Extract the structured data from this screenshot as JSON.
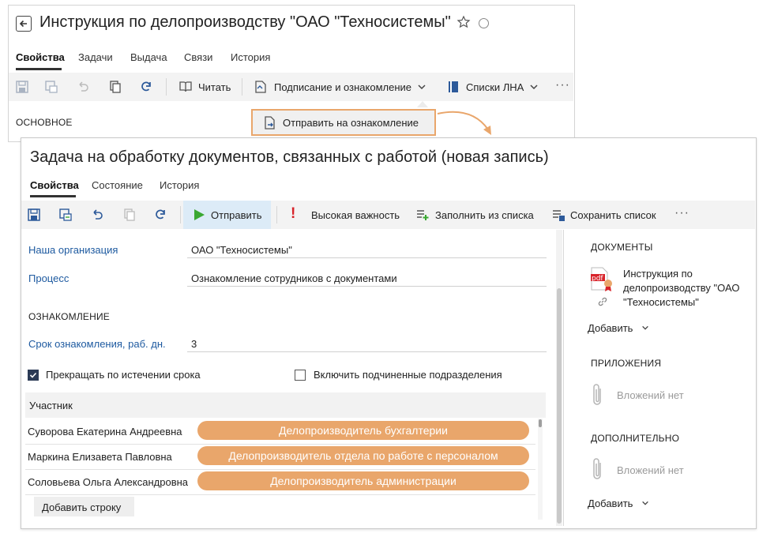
{
  "back_window": {
    "title": "Инструкция по делопроизводству \"ОАО \"Техносистемы\"",
    "tabs": [
      "Свойства",
      "Задачи",
      "Выдача",
      "Связи",
      "История"
    ],
    "toolbar": {
      "read_label": "Читать",
      "sign_label": "Подписание и ознакомление",
      "lna_label": "Списки ЛНА"
    },
    "section_label": "ОСНОВНОЕ",
    "dropdown_item": "Отправить на ознакомление"
  },
  "front_window": {
    "title": "Задача на обработку документов, связанных с работой (новая запись)",
    "tabs": [
      "Свойства",
      "Состояние",
      "История"
    ],
    "toolbar": {
      "send_label": "Отправить",
      "importance_label": "Высокая важность",
      "fill_label": "Заполнить из списка",
      "save_list_label": "Сохранить список"
    },
    "fields": {
      "org_label": "Наша организация",
      "org_value": "ОАО \"Техносистемы\"",
      "process_label": "Процесс",
      "process_value": "Ознакомление сотрудников с документами",
      "familiarization_header": "ОЗНАКОМЛЕНИЕ",
      "term_label": "Срок ознакомления, раб. дн.",
      "term_value": "3"
    },
    "checkboxes": {
      "stop_on_expiry": {
        "label": "Прекращать по истечении срока",
        "checked": true
      },
      "include_subdivisions": {
        "label": "Включить подчиненные подразделения",
        "checked": false
      }
    },
    "table": {
      "header": "Участник",
      "rows": [
        {
          "name": "Суворова Екатерина Андреевна",
          "role": "Делопроизводитель бухгалтерии"
        },
        {
          "name": "Маркина Елизавета Павловна",
          "role": "Делопроизводитель отдела по работе с персоналом"
        },
        {
          "name": "Соловьева Ольга Александровна",
          "role": "Делопроизводитель администрации"
        }
      ],
      "add_row_label": "Добавить строку"
    },
    "side_panel": {
      "documents_header": "ДОКУМЕНТЫ",
      "document_name": "Инструкция по делопроизводству \"ОАО \"Техносистемы\"",
      "pdf_badge": "pdf",
      "add_label": "Добавить",
      "attachments_header": "ПРИЛОЖЕНИЯ",
      "no_attachments": "Вложений нет",
      "additional_header": "ДОПОЛНИТЕЛЬНО",
      "no_attachments_2": "Вложений нет",
      "add_label_2": "Добавить"
    }
  },
  "colors": {
    "accent_orange": "#e9a66b",
    "link_blue": "#1e5aa0",
    "send_green": "#3aa832",
    "alert_red": "#d8232a",
    "icon_blue": "#2d5a9a"
  }
}
